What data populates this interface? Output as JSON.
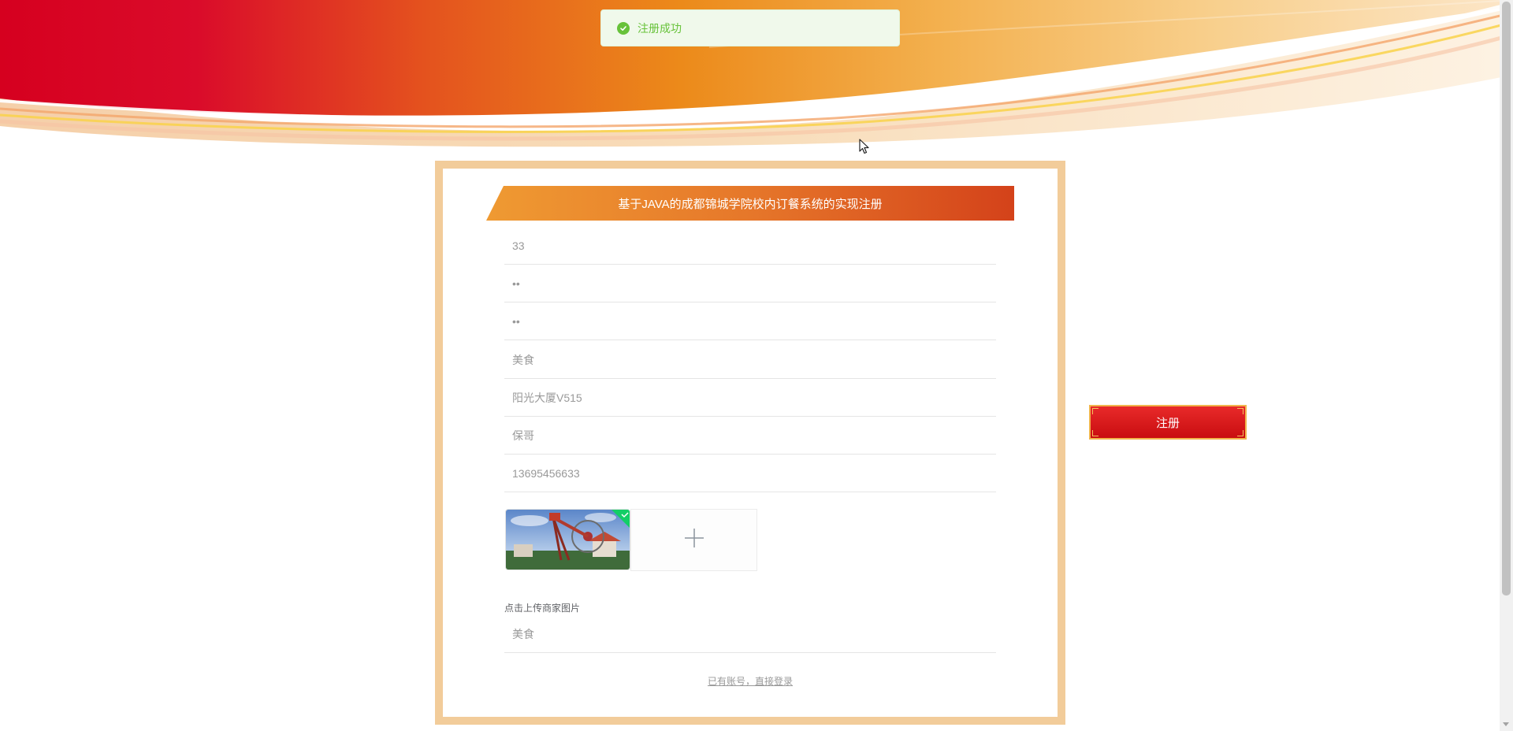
{
  "toast": {
    "message": "注册成功",
    "icon": "check-circle-icon",
    "color": "#67c23a"
  },
  "form": {
    "title": "基于JAVA的成都锦城学院校内订餐系统的实现注册",
    "fields": [
      {
        "value": "33"
      },
      {
        "value": "••"
      },
      {
        "value": "••"
      },
      {
        "value": "美食"
      },
      {
        "value": "阳光大厦V515"
      },
      {
        "value": "保哥"
      },
      {
        "value": "13695456633"
      }
    ],
    "upload": {
      "add_icon": "plus-icon",
      "tip": "点击上传商家图片"
    },
    "category_field": {
      "value": "美食"
    },
    "login_link": "已有账号，直接登录"
  },
  "register_button": {
    "label": "注册"
  },
  "colors": {
    "panel_border": "#f2cc9a",
    "title_gradient_start": "#ef9a32",
    "title_gradient_end": "#d4421a",
    "button_red": "#d9151a",
    "button_border": "#f1b44c"
  }
}
